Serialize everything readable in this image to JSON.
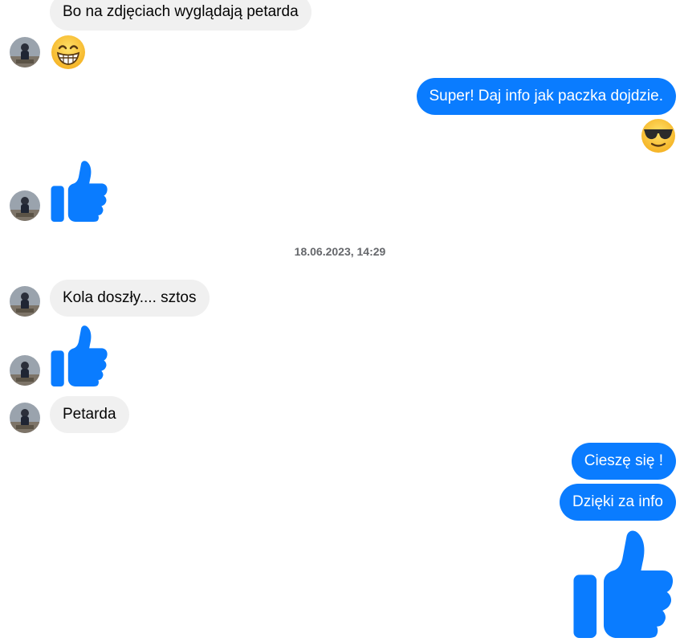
{
  "conversation": {
    "messages": [
      {
        "sender": "them",
        "text": "Bo na zdjęciach wyglądają petarda"
      },
      {
        "sender": "them",
        "icon": "grinning-face-emoji"
      },
      {
        "sender": "me",
        "text": "Super! Daj info jak paczka dojdzie."
      },
      {
        "sender": "me",
        "icon": "sunglasses-face-emoji"
      },
      {
        "sender": "them",
        "icon": "thumbs-up-icon"
      },
      {
        "sender": "them",
        "text": "Kola doszły.... sztos"
      },
      {
        "sender": "them",
        "icon": "thumbs-up-icon"
      },
      {
        "sender": "them",
        "text": "Petarda"
      },
      {
        "sender": "me",
        "text": "Cieszę się !"
      },
      {
        "sender": "me",
        "text": "Dzięki za info"
      },
      {
        "sender": "me",
        "icon": "thumbs-up-icon"
      }
    ],
    "timestamp": "18.06.2023, 14:29"
  },
  "colors": {
    "outgoing_bubble": "#0a7cff",
    "incoming_bubble": "#f0f0f0",
    "thumbs_up": "#0a7cff",
    "timestamp_text": "#65676b"
  }
}
